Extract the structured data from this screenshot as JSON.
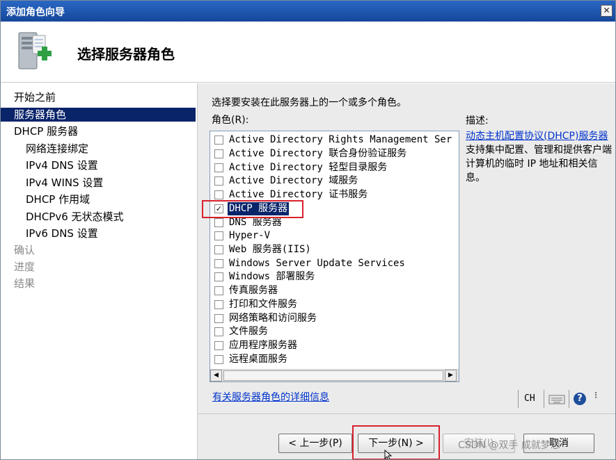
{
  "window": {
    "title": "添加角色向导",
    "close_glyph": "✕"
  },
  "header": {
    "title": "选择服务器角色",
    "icon": "server-add-icon"
  },
  "nav": {
    "items": [
      {
        "label": "开始之前",
        "state": "normal"
      },
      {
        "label": "服务器角色",
        "state": "selected"
      },
      {
        "label": "DHCP 服务器",
        "state": "normal"
      },
      {
        "label": "网络连接绑定",
        "state": "normal"
      },
      {
        "label": "IPv4 DNS 设置",
        "state": "normal"
      },
      {
        "label": "IPv4 WINS 设置",
        "state": "normal"
      },
      {
        "label": "DHCP 作用域",
        "state": "normal"
      },
      {
        "label": "DHCPv6 无状态模式",
        "state": "normal"
      },
      {
        "label": "IPv6 DNS 设置",
        "state": "normal"
      },
      {
        "label": "确认",
        "state": "disabled"
      },
      {
        "label": "进度",
        "state": "disabled"
      },
      {
        "label": "结果",
        "state": "disabled"
      }
    ]
  },
  "main": {
    "instruction": "选择要安装在此服务器上的一个或多个角色。",
    "roles_label": "角色(R):",
    "roles": [
      {
        "label": "Active Directory Rights Management Ser",
        "checked": false
      },
      {
        "label": "Active Directory 联合身份验证服务",
        "checked": false
      },
      {
        "label": "Active Directory 轻型目录服务",
        "checked": false
      },
      {
        "label": "Active Directory 域服务",
        "checked": false
      },
      {
        "label": "Active Directory 证书服务",
        "checked": false
      },
      {
        "label": "DHCP 服务器",
        "checked": true,
        "selected": true
      },
      {
        "label": "DNS 服务器",
        "checked": false
      },
      {
        "label": "Hyper-V",
        "checked": false
      },
      {
        "label": "Web 服务器(IIS)",
        "checked": false
      },
      {
        "label": "Windows Server Update Services",
        "checked": false
      },
      {
        "label": "Windows 部署服务",
        "checked": false
      },
      {
        "label": "传真服务器",
        "checked": false
      },
      {
        "label": "打印和文件服务",
        "checked": false
      },
      {
        "label": "网络策略和访问服务",
        "checked": false
      },
      {
        "label": "文件服务",
        "checked": false
      },
      {
        "label": "应用程序服务器",
        "checked": false
      },
      {
        "label": "远程桌面服务",
        "checked": false
      }
    ],
    "scroll": {
      "left_arrow": "◀",
      "right_arrow": "▶"
    },
    "description": {
      "label": "描述:",
      "link_text": "动态主机配置协议(DHCP)服务器",
      "text": "支持集中配置、管理和提供客户端计算机的临时 IP 地址和相关信息。"
    },
    "more_info_link": "有关服务器角色的详细信息"
  },
  "tray": {
    "language": "CH",
    "help_glyph": "?",
    "more_glyph": "⁝"
  },
  "footer": {
    "prev_label": "< 上一步(P)",
    "next_label": "下一步(N) >",
    "install_label": "安装(I)",
    "cancel_label": "取消",
    "watermark": "CSDN @双手  成就梦想"
  },
  "colors": {
    "selection": "#0a246a",
    "link": "#0033cc",
    "highlight_box": "#d8202c",
    "panel": "#ebebeb"
  }
}
